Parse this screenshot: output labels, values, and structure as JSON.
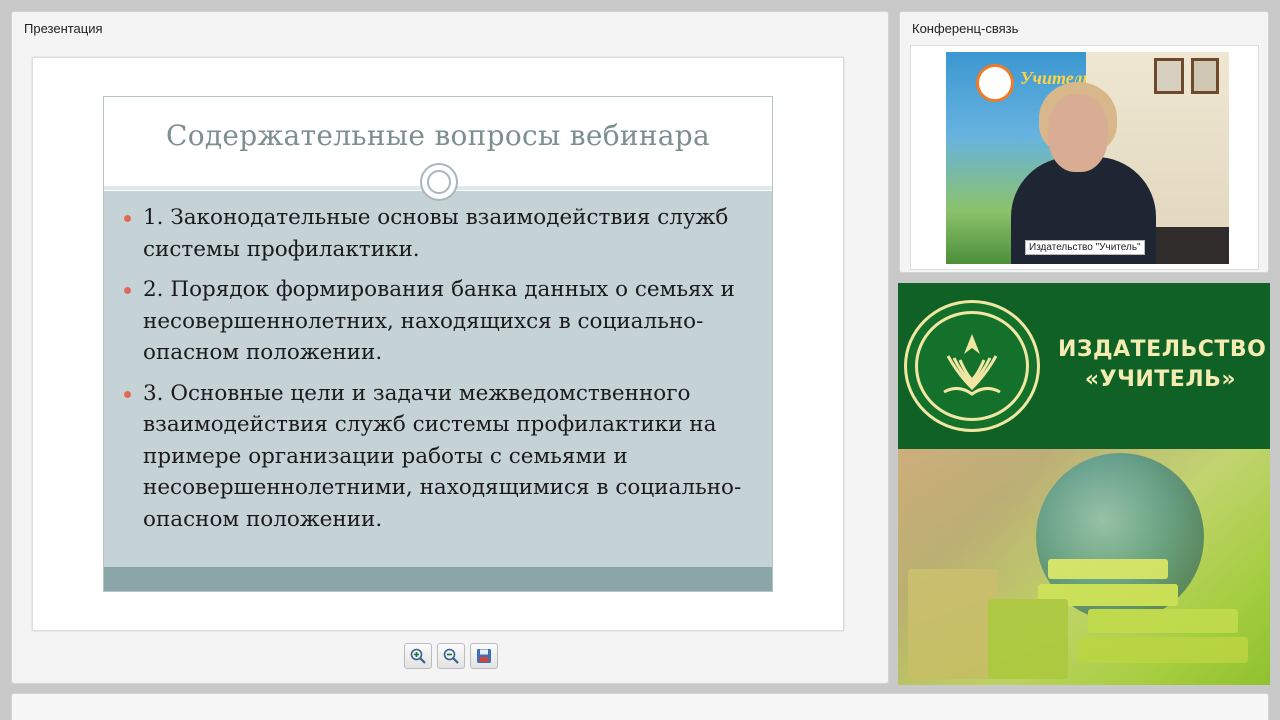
{
  "presentation": {
    "title": "Презентация",
    "slide": {
      "title": "Содержательные вопросы вебинара",
      "items": [
        "1. Законодательные основы взаимодействия служб системы профилактики.",
        "2. Порядок формирования банка данных о семьях и несовершеннолетних, находящихся в социально-опасном положении.",
        "3. Основные цели и задачи межведомственного взаимодействия служб системы профилактики на примере организации работы с семьями и несовершеннолетними, находящимися в социально-опасном положении."
      ]
    },
    "toolbar": {
      "zoom_in_icon": "zoom-in-icon",
      "zoom_out_icon": "zoom-out-icon",
      "save_icon": "save-icon"
    }
  },
  "conference": {
    "title": "Конференц-связь",
    "speaker_label": "Издательство \"Учитель\"",
    "banner_text": "Учитель"
  },
  "ad": {
    "line1": "ИЗДАТЕЛЬСТВО",
    "line2": "«УЧИТЕЛЬ»"
  },
  "colors": {
    "slide_bg": "#c6d3d6",
    "bullet": "#e06a59",
    "ad_green": "#0f6125",
    "ad_text": "#f5ecb2"
  }
}
